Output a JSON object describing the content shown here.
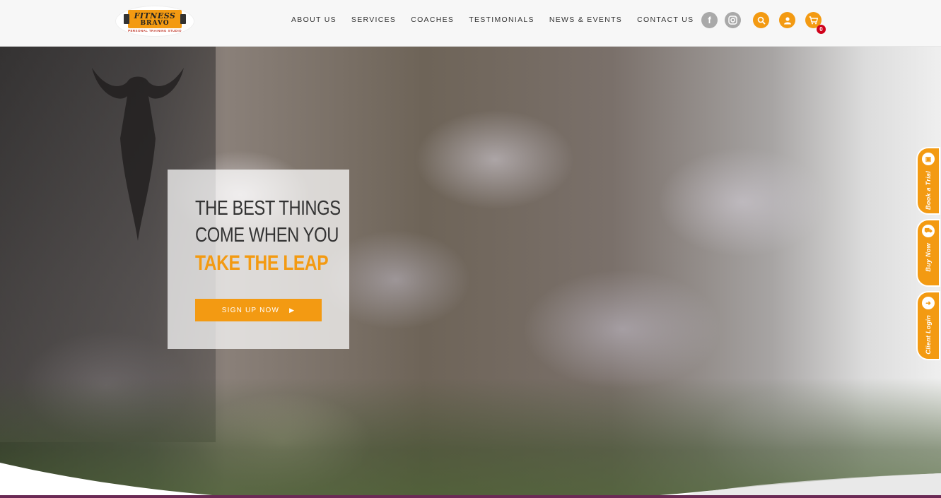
{
  "brand": {
    "line1": "FITNESS",
    "line2": "BRAVO",
    "tagline": "PERSONAL TRAINING STUDIO"
  },
  "nav": {
    "items": [
      {
        "label": "ABOUT US"
      },
      {
        "label": "SERVICES"
      },
      {
        "label": "COACHES"
      },
      {
        "label": "TESTIMONIALS"
      },
      {
        "label": "NEWS & EVENTS"
      },
      {
        "label": "CONTACT US"
      }
    ]
  },
  "header_icons": {
    "facebook": "f",
    "instagram": "◎",
    "search": "⚲",
    "account": "●",
    "cart": "🛒",
    "cart_count": "0"
  },
  "hero": {
    "line1": "THE BEST THINGS",
    "line2": "COME WHEN YOU",
    "line3": "TAKE THE LEAP",
    "cta_label": "SIGN UP NOW",
    "cta_arrow": "▶"
  },
  "side_tabs": [
    {
      "label": "Book a Trial",
      "icon": "▣"
    },
    {
      "label": "Buy Now",
      "icon": "⛟"
    },
    {
      "label": "Client Login",
      "icon": "➜"
    }
  ],
  "colors": {
    "accent": "#f39a12",
    "badge": "#d0021b",
    "icon_grey": "#a9a9a9"
  }
}
